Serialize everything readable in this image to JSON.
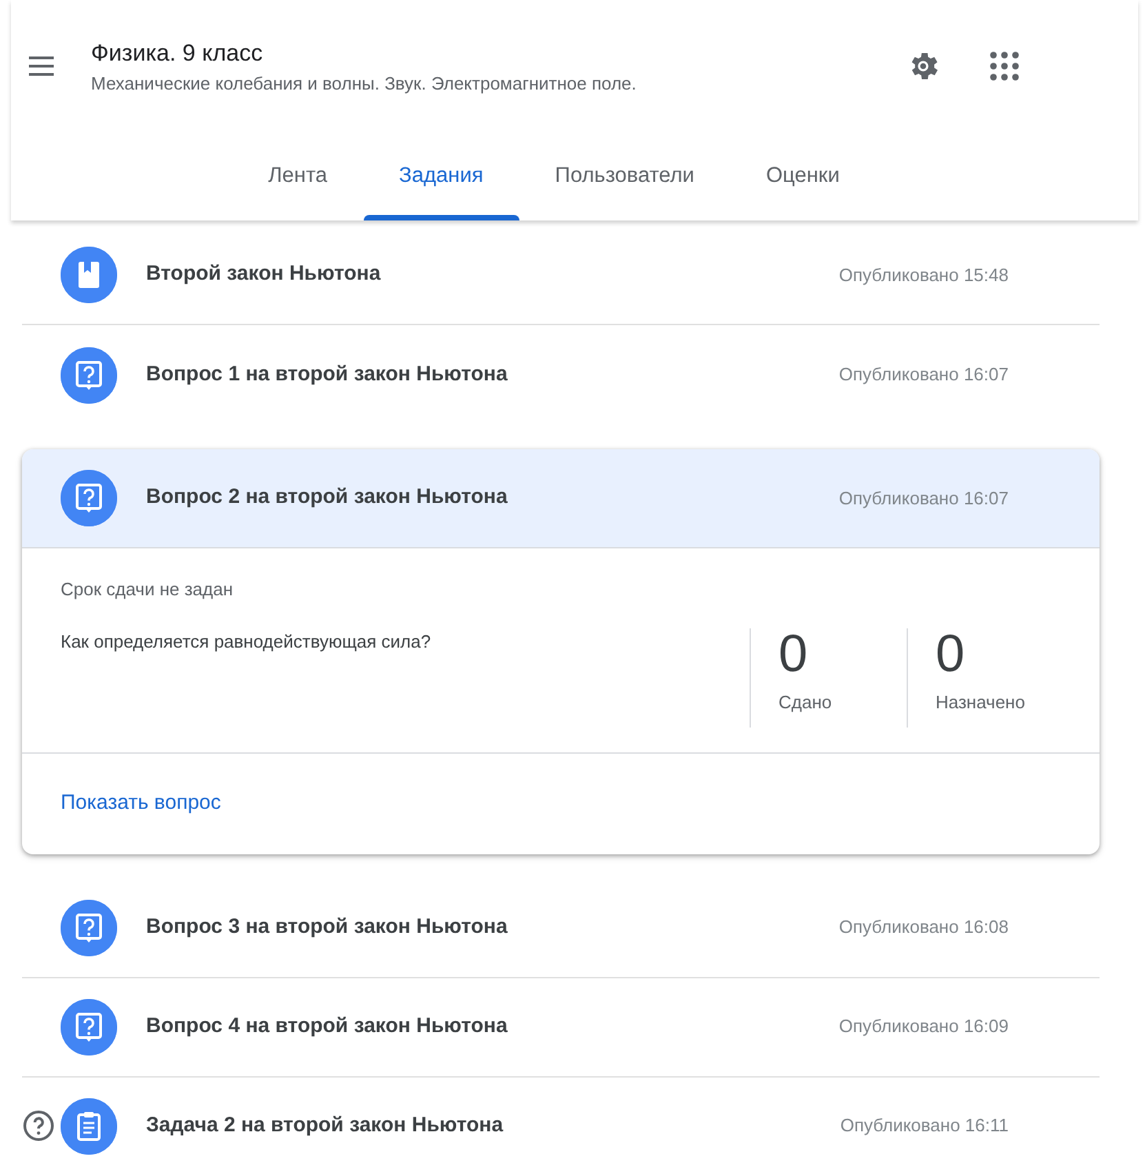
{
  "header": {
    "title": "Физика. 9 класс",
    "subtitle": "Механические колебания и волны. Звук. Электромагнитное поле."
  },
  "tabs": [
    {
      "label": "Лента",
      "selected": false
    },
    {
      "label": "Задания",
      "selected": true
    },
    {
      "label": "Пользователи",
      "selected": false
    },
    {
      "label": "Оценки",
      "selected": false
    }
  ],
  "items": [
    {
      "kind": "material",
      "title": "Второй закон Ньютона",
      "time": "Опубликовано 15:48",
      "expanded": false
    },
    {
      "kind": "question",
      "title": "Вопрос 1 на второй закон Ньютона",
      "time": "Опубликовано 16:07",
      "expanded": false
    },
    {
      "kind": "question",
      "title": "Вопрос 2 на второй закон Ньютона",
      "time": "Опубликовано 16:07",
      "expanded": true,
      "due": "Срок сдачи не задан",
      "question": "Как определяется равнодействующая сила?",
      "stats": [
        {
          "value": "0",
          "label": "Сдано"
        },
        {
          "value": "0",
          "label": "Назначено"
        }
      ],
      "link": "Показать вопрос"
    },
    {
      "kind": "question",
      "title": "Вопрос 3 на второй закон Ньютона",
      "time": "Опубликовано 16:08",
      "expanded": false
    },
    {
      "kind": "question",
      "title": "Вопрос 4 на второй закон Ньютона",
      "time": "Опубликовано 16:09",
      "expanded": false
    },
    {
      "kind": "assignment",
      "title": "Задача 2 на второй закон Ньютона",
      "time": "Опубликовано 16:11",
      "expanded": false
    }
  ]
}
